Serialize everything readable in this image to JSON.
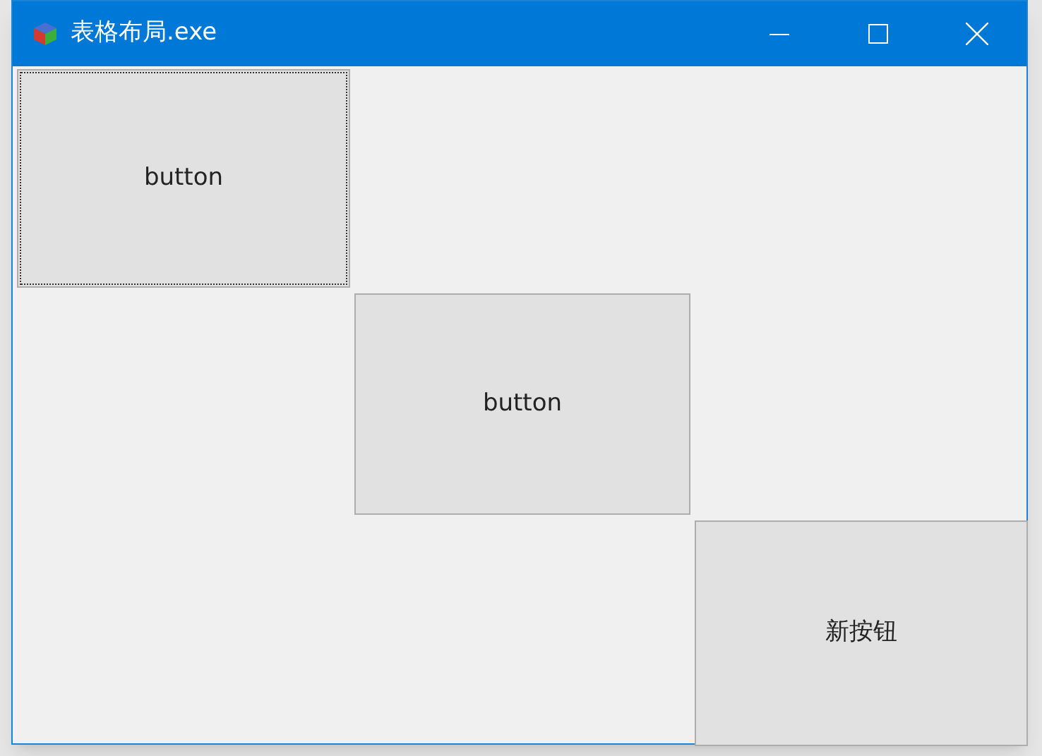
{
  "window": {
    "title": "表格布局.exe"
  },
  "buttons": [
    {
      "label": "button",
      "focused": true
    },
    {
      "label": "button",
      "focused": false
    },
    {
      "label": "新按钮",
      "focused": false
    }
  ]
}
